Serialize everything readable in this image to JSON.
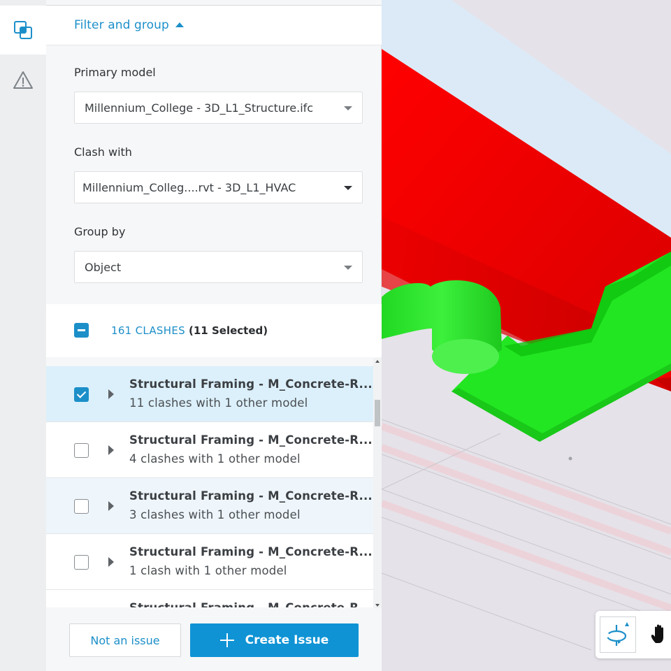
{
  "rail": {
    "items": [
      {
        "icon": "clash-overlap-icon",
        "active": true
      },
      {
        "icon": "warning-icon",
        "active": false
      }
    ]
  },
  "panel": {
    "section_title": "Filter and group",
    "primary_model": {
      "label": "Primary model",
      "value": "Millennium_College - 3D_L1_Structure.ifc"
    },
    "clash_with": {
      "label": "Clash with",
      "value": "Millennium_Colleg....rvt - 3D_L1_HVAC"
    },
    "group_by": {
      "label": "Group by",
      "value": "Object"
    },
    "clashes": {
      "count_label": "161 CLASHES",
      "selected_label": "(11 Selected)",
      "select_state": "indeterminate"
    },
    "rows": [
      {
        "title": "Structural Framing - M_Concrete-R...",
        "subtitle": "11 clashes with 1 other model",
        "checked": true
      },
      {
        "title": "Structural Framing - M_Concrete-R...",
        "subtitle": "4 clashes with 1 other model",
        "checked": false
      },
      {
        "title": "Structural Framing - M_Concrete-R...",
        "subtitle": "3 clashes with 1 other model",
        "checked": false
      },
      {
        "title": "Structural Framing - M_Concrete-R...",
        "subtitle": "1 clash with 1 other model",
        "checked": false
      },
      {
        "title": "Structural Framing - M_Concrete-R...",
        "subtitle": "",
        "checked": false
      }
    ],
    "footer": {
      "secondary_label": "Not an issue",
      "primary_label": "Create Issue"
    }
  },
  "viewer": {
    "colors": {
      "primary_model": "#ff0000",
      "clash_model": "#22e622",
      "accent": "#1c8fc9"
    },
    "tools": [
      {
        "name": "orbit",
        "icon": "orbit-icon",
        "active": true
      },
      {
        "name": "pan",
        "icon": "pan-hand-icon",
        "active": false
      }
    ]
  }
}
